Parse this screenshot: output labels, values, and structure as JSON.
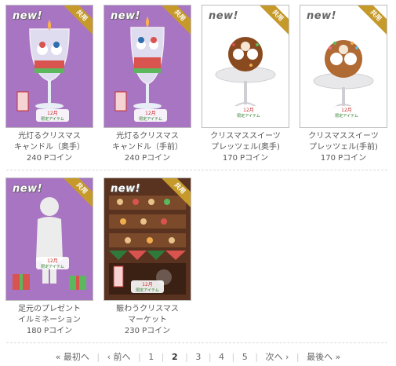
{
  "items": [
    {
      "badge_new": "new!",
      "badge_shared": "共用",
      "name_line1": "光灯るクリスマス",
      "name_line2": "キャンドル（奥手）",
      "price": "240 Pコイン",
      "style": "purple"
    },
    {
      "badge_new": "new!",
      "badge_shared": "共用",
      "name_line1": "光灯るクリスマス",
      "name_line2": "キャンドル（手前）",
      "price": "240 Pコイン",
      "style": "purple"
    },
    {
      "badge_new": "new!",
      "badge_shared": "共用",
      "name_line1": "クリスマススイーツ",
      "name_line2": "プレッツェル(奥手)",
      "price": "170 Pコイン",
      "style": "white"
    },
    {
      "badge_new": "new!",
      "badge_shared": "共用",
      "name_line1": "クリスマススイーツ",
      "name_line2": "プレッツェル(手前)",
      "price": "170 Pコイン",
      "style": "white"
    },
    {
      "badge_new": "new!",
      "badge_shared": "共用",
      "name_line1": "足元のプレゼント",
      "name_line2": "イルミネーション",
      "price": "180 Pコイン",
      "style": "purple"
    },
    {
      "badge_new": "new!",
      "badge_shared": "共用",
      "name_line1": "賑わうクリスマス",
      "name_line2": "マーケット",
      "price": "230 Pコイン",
      "style": "market"
    }
  ],
  "limited_label": "限定アイテム",
  "month_label": "12月",
  "pagination": {
    "first": "« 最初へ",
    "prev": "‹ 前へ",
    "pages": [
      "1",
      "2",
      "3",
      "4",
      "5"
    ],
    "current": "2",
    "next": "次へ ›",
    "last": "最後へ »"
  }
}
